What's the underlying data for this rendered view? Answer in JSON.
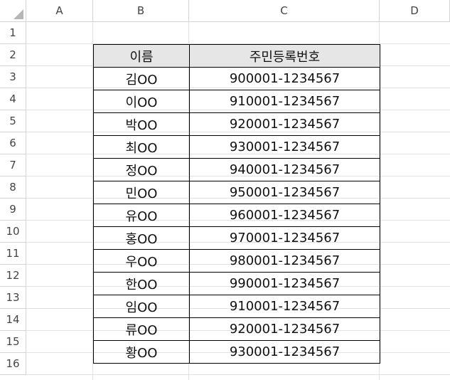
{
  "columns": [
    "A",
    "B",
    "C",
    "D"
  ],
  "rows": [
    "1",
    "2",
    "3",
    "4",
    "5",
    "6",
    "7",
    "8",
    "9",
    "10",
    "11",
    "12",
    "13",
    "14",
    "15",
    "16"
  ],
  "table": {
    "headers": [
      "이름",
      "주민등록번호"
    ],
    "records": [
      {
        "name": "김OO",
        "id": "900001-1234567"
      },
      {
        "name": "이OO",
        "id": "910001-1234567"
      },
      {
        "name": "박OO",
        "id": "920001-1234567"
      },
      {
        "name": "최OO",
        "id": "930001-1234567"
      },
      {
        "name": "정OO",
        "id": "940001-1234567"
      },
      {
        "name": "민OO",
        "id": "950001-1234567"
      },
      {
        "name": "유OO",
        "id": "960001-1234567"
      },
      {
        "name": "홍OO",
        "id": "970001-1234567"
      },
      {
        "name": "우OO",
        "id": "980001-1234567"
      },
      {
        "name": "한OO",
        "id": "990001-1234567"
      },
      {
        "name": "임OO",
        "id": "910001-1234567"
      },
      {
        "name": "류OO",
        "id": "920001-1234567"
      },
      {
        "name": "황OO",
        "id": "930001-1234567"
      }
    ]
  },
  "colors": {
    "header_fill": "#e7e6e6",
    "grid": "#e1e1e1",
    "border": "#000000"
  }
}
